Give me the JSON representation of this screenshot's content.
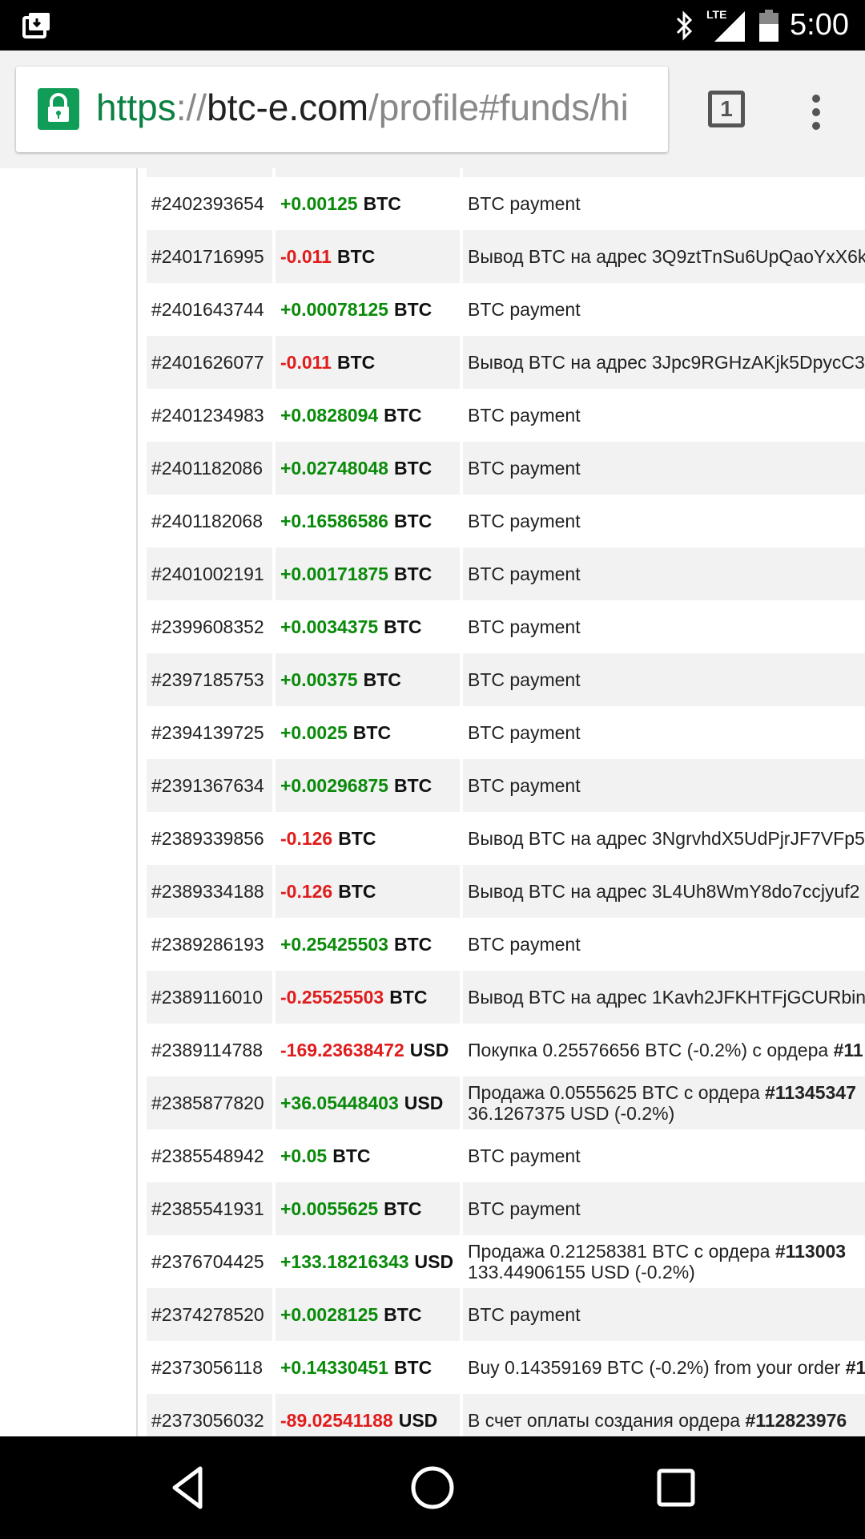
{
  "status_bar": {
    "network": "LTE",
    "time": "5:00"
  },
  "browser": {
    "url_scheme": "https",
    "url_sep": "://",
    "url_host": "btc-e.com",
    "url_path": "/profile#funds/hi",
    "tab_count": "1"
  },
  "rows": [
    {
      "id": "#2402393654",
      "amount": "+0.00125",
      "sign": "pos",
      "currency": "BTC",
      "desc": "BTC payment"
    },
    {
      "id": "#2401716995",
      "amount": "-0.011",
      "sign": "neg",
      "currency": "BTC",
      "desc": "Вывод BTC на адрес 3Q9ztTnSu6UpQaoYxX6k"
    },
    {
      "id": "#2401643744",
      "amount": "+0.00078125",
      "sign": "pos",
      "currency": "BTC",
      "desc": "BTC payment"
    },
    {
      "id": "#2401626077",
      "amount": "-0.011",
      "sign": "neg",
      "currency": "BTC",
      "desc": "Вывод BTC на адрес 3Jpc9RGHzAKjk5DpycC3"
    },
    {
      "id": "#2401234983",
      "amount": "+0.0828094",
      "sign": "pos",
      "currency": "BTC",
      "desc": "BTC payment"
    },
    {
      "id": "#2401182086",
      "amount": "+0.02748048",
      "sign": "pos",
      "currency": "BTC",
      "desc": "BTC payment"
    },
    {
      "id": "#2401182068",
      "amount": "+0.16586586",
      "sign": "pos",
      "currency": "BTC",
      "desc": "BTC payment"
    },
    {
      "id": "#2401002191",
      "amount": "+0.00171875",
      "sign": "pos",
      "currency": "BTC",
      "desc": "BTC payment"
    },
    {
      "id": "#2399608352",
      "amount": "+0.0034375",
      "sign": "pos",
      "currency": "BTC",
      "desc": "BTC payment"
    },
    {
      "id": "#2397185753",
      "amount": "+0.00375",
      "sign": "pos",
      "currency": "BTC",
      "desc": "BTC payment"
    },
    {
      "id": "#2394139725",
      "amount": "+0.0025",
      "sign": "pos",
      "currency": "BTC",
      "desc": "BTC payment"
    },
    {
      "id": "#2391367634",
      "amount": "+0.00296875",
      "sign": "pos",
      "currency": "BTC",
      "desc": "BTC payment"
    },
    {
      "id": "#2389339856",
      "amount": "-0.126",
      "sign": "neg",
      "currency": "BTC",
      "desc": "Вывод BTC на адрес 3NgrvhdX5UdPjrJF7VFp5"
    },
    {
      "id": "#2389334188",
      "amount": "-0.126",
      "sign": "neg",
      "currency": "BTC",
      "desc": "Вывод BTC на адрес 3L4Uh8WmY8do7ccjyuf2"
    },
    {
      "id": "#2389286193",
      "amount": "+0.25425503",
      "sign": "pos",
      "currency": "BTC",
      "desc": "BTC payment"
    },
    {
      "id": "#2389116010",
      "amount": "-0.25525503",
      "sign": "neg",
      "currency": "BTC",
      "desc": "Вывод BTC на адрес 1Kavh2JFKHTFjGCURbin"
    },
    {
      "id": "#2389114788",
      "amount": "-169.23638472",
      "sign": "neg",
      "currency": "USD",
      "desc": "Покупка 0.25576656 BTC (-0.2%) с ордера",
      "desc_bold": "#11"
    },
    {
      "id": "#2385877820",
      "amount": "+36.05448403",
      "sign": "pos",
      "currency": "USD",
      "desc": "Продажа 0.0555625 BTC с ордера",
      "desc_bold": "#11345347",
      "desc2": "36.1267375 USD (-0.2%)"
    },
    {
      "id": "#2385548942",
      "amount": "+0.05",
      "sign": "pos",
      "currency": "BTC",
      "desc": "BTC payment"
    },
    {
      "id": "#2385541931",
      "amount": "+0.0055625",
      "sign": "pos",
      "currency": "BTC",
      "desc": "BTC payment"
    },
    {
      "id": "#2376704425",
      "amount": "+133.18216343",
      "sign": "pos",
      "currency": "USD",
      "desc": "Продажа 0.21258381 BTC с ордера",
      "desc_bold": "#113003",
      "desc2": "133.44906155 USD (-0.2%)"
    },
    {
      "id": "#2374278520",
      "amount": "+0.0028125",
      "sign": "pos",
      "currency": "BTC",
      "desc": "BTC payment"
    },
    {
      "id": "#2373056118",
      "amount": "+0.14330451",
      "sign": "pos",
      "currency": "BTC",
      "desc": "Buy 0.14359169 BTC (-0.2%) from your order",
      "desc_bold": "#1"
    },
    {
      "id": "#2373056032",
      "amount": "-89.02541188",
      "sign": "neg",
      "currency": "USD",
      "desc": "В счет оплаты создания ордера",
      "desc_bold": "#112823976"
    }
  ]
}
